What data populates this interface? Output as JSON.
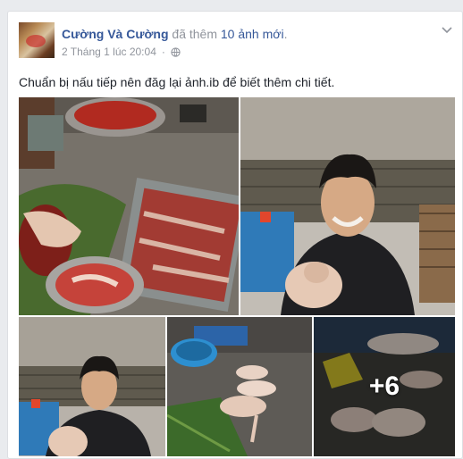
{
  "post": {
    "author": "Cường Và Cường",
    "action": "đã thêm",
    "photos_link": "10 ảnh mới",
    "period": ".",
    "timestamp": "2 Tháng 1 lúc 20:04",
    "separator": "·",
    "text": "Chuẩn bị nấu tiếp nên đăg lại ảnh.ib để biết thêm chi tiết.",
    "more_photos_count": "+6"
  },
  "icons": {
    "privacy": "globe-icon",
    "options": "chevron-down-icon"
  },
  "colors": {
    "link": "#365899",
    "meta": "#90949c",
    "text": "#1d2129",
    "background": "#e9ebee"
  }
}
